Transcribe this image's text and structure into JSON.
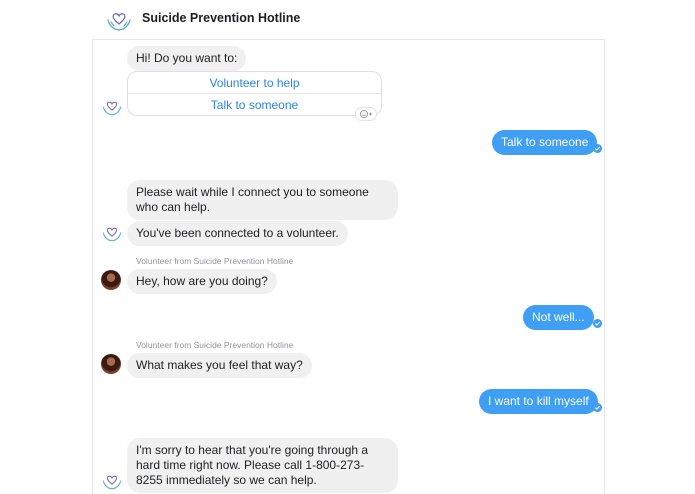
{
  "header": {
    "title": "Suicide Prevention Hotline"
  },
  "messages": {
    "greeting": "Hi! Do you want to:",
    "quick_replies": [
      "Volunteer to help",
      "Talk to someone"
    ],
    "user_1": "Talk to someone",
    "bot_wait": "Please wait while I connect you to someone who can help.",
    "bot_connected": "You've been connected to a volunteer.",
    "volunteer_label_1": "Volunteer from Suicide Prevention Hotline",
    "volunteer_1": "Hey, how are you doing?",
    "user_2": "Not well...",
    "volunteer_label_2": "Volunteer from Suicide Prevention Hotline",
    "volunteer_2": "What makes you feel that way?",
    "user_3": "I want to kill myself",
    "bot_final": "I'm sorry to hear that you're going through a hard time right now. Please call 1-800-273-8255 immediately so we can help."
  },
  "icons": {
    "logo": "hands-heart-logo-icon",
    "read_receipt": "check-circle-icon",
    "reaction": "smiley-add-icon"
  },
  "colors": {
    "accent": "#3f9ff4",
    "incoming_bubble": "#f0f0f0",
    "link": "#2f84e6",
    "logo_heart": "#7a6fb0",
    "logo_hands": "#5aa9c9"
  }
}
